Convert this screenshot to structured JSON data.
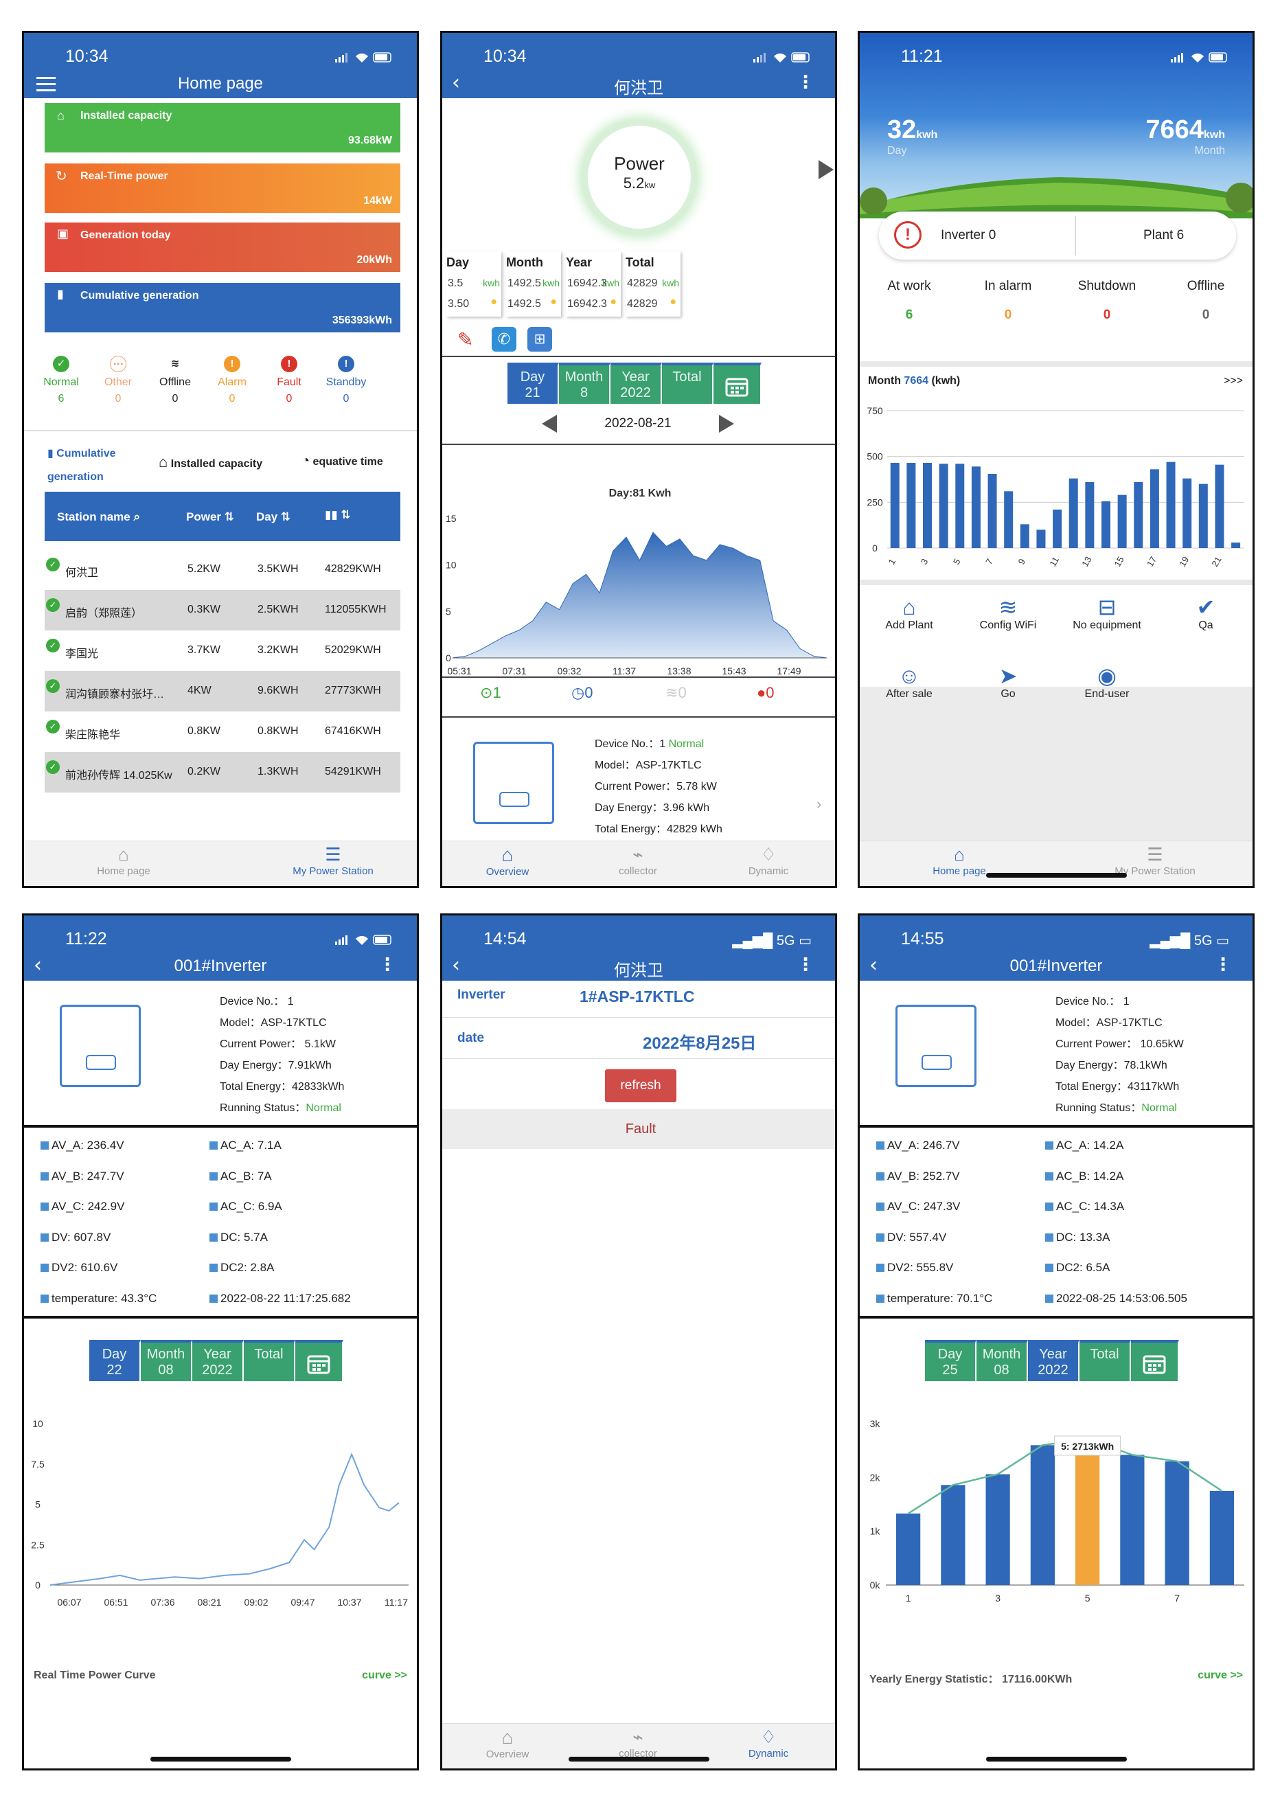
{
  "screens": {
    "s1": {
      "time": "10:34",
      "title": "Home page",
      "cards": [
        {
          "label": "Installed capacity",
          "value": "93.68kW"
        },
        {
          "label": "Real-Time power",
          "value": "14kW"
        },
        {
          "label": "Generation today",
          "value": "20kWh"
        },
        {
          "label": "Cumulative generation",
          "value": "356393kWh"
        }
      ],
      "statuses": [
        {
          "label": "Normal",
          "count": "6",
          "color": "#3caa3c"
        },
        {
          "label": "Other",
          "count": "0",
          "color": "#f0a070"
        },
        {
          "label": "Offline",
          "count": "0",
          "color": "#222222"
        },
        {
          "label": "Alarm",
          "count": "0",
          "color": "#f39a2c"
        },
        {
          "label": "Fault",
          "count": "0",
          "color": "#d9342b"
        },
        {
          "label": "Standby",
          "count": "0",
          "color": "#2f68b8"
        }
      ],
      "sort": {
        "cumulative": "Cumulative generation",
        "installed": "Installed capacity",
        "equative": "equative time"
      },
      "table": {
        "headers": [
          "Station name",
          "Power",
          "Day",
          ""
        ],
        "rows": [
          [
            "何洪卫",
            "5.2KW",
            "3.5KWH",
            "42829KWH"
          ],
          [
            "启韵（郑照莲）",
            "0.3KW",
            "2.5KWH",
            "112055KWH"
          ],
          [
            "李国光",
            "3.7KW",
            "3.2KWH",
            "52029KWH"
          ],
          [
            "润沟镇顾寨村张圩…",
            "4KW",
            "9.6KWH",
            "27773KWH"
          ],
          [
            "柴庄陈艳华",
            "0.8KW",
            "0.8KWH",
            "67416KWH"
          ],
          [
            "前池孙传辉 14.025Kw",
            "0.2KW",
            "1.3KWH",
            "54291KWH"
          ]
        ]
      },
      "tabs": [
        "Home page",
        "My Power Station"
      ]
    },
    "s2": {
      "time": "10:34",
      "title": "何洪卫",
      "gauge_label": "Power",
      "gauge_value": "5.2",
      "gauge_unit": "kw",
      "stats": [
        {
          "label": "Day",
          "a": "3.5",
          "b": "3.50",
          "unit": "kwh"
        },
        {
          "label": "Month",
          "a": "1492.5",
          "b": "1492.5",
          "unit": "kwh"
        },
        {
          "label": "Year",
          "a": "16942.3",
          "b": "16942.3",
          "unit": "kwh"
        },
        {
          "label": "Total",
          "a": "42829",
          "b": "42829",
          "unit": "kwh"
        }
      ],
      "seg": [
        {
          "l": "Day",
          "v": "21"
        },
        {
          "l": "Month",
          "v": "8"
        },
        {
          "l": "Year",
          "v": "2022"
        },
        {
          "l": "Total",
          "v": ""
        }
      ],
      "date": "2022-08-21",
      "chart_title": "Day:81 Kwh",
      "icons_counts": [
        "1",
        "0",
        "0",
        "0"
      ],
      "device": {
        "no_label": "Device No.：",
        "no": "1",
        "status": "Normal",
        "model": "Model：ASP-17KTLC",
        "power": "Current Power：5.78 kW",
        "day": "Day Energy：3.96 kWh",
        "total": "Total Energy：42829 kWh"
      },
      "tabs": [
        "Overview",
        "collector",
        "Dynamic"
      ]
    },
    "s3": {
      "time": "11:21",
      "day_value": "32",
      "day_unit": "kwh",
      "day_label": "Day",
      "month_value": "7664",
      "month_unit": "kwh",
      "month_label": "Month",
      "inverter": "Inverter 0",
      "plant": "Plant 6",
      "states": [
        {
          "label": "At work",
          "v": "6",
          "c": "#3caa3c"
        },
        {
          "label": "In alarm",
          "v": "0",
          "c": "#f39a2c"
        },
        {
          "label": "Shutdown",
          "v": "0",
          "c": "#d9342b"
        },
        {
          "label": "Offline",
          "v": "0",
          "c": "#666666"
        }
      ],
      "month_title_a": "Month ",
      "month_title_b": "7664",
      "month_title_c": " (kwh)",
      "more": ">>>",
      "tools": [
        "Add Plant",
        "Config WiFi",
        "No equipment",
        "Qa",
        "After sale",
        "Go",
        "End-user"
      ],
      "tabs": [
        "Home page",
        "My Power Station"
      ]
    },
    "s4": {
      "time": "11:22",
      "title": "001#Inverter",
      "device": {
        "no": "Device No.：  1",
        "model": "Model：ASP-17KTLC",
        "power": "Current Power：  5.1kW",
        "day": "Day Energy：7.91kWh",
        "total": "Total Energy：42833kWh",
        "run_label": "Running Status：",
        "run": "Normal"
      },
      "params": [
        "AV_A: 236.4V",
        "AC_A: 7.1A",
        "AV_B: 247.7V",
        "AC_B: 7A",
        "AV_C: 242.9V",
        "AC_C: 6.9A",
        "DV: 607.8V",
        "DC: 5.7A",
        "DV2: 610.6V",
        "DC2: 2.8A",
        "temperature:    43.3°C",
        "2022-08-22 11:17:25.682"
      ],
      "seg": [
        {
          "l": "Day",
          "v": "22"
        },
        {
          "l": "Month",
          "v": "08"
        },
        {
          "l": "Year",
          "v": "2022"
        },
        {
          "l": "Total",
          "v": ""
        }
      ],
      "footer": "Real Time Power Curve",
      "curve": "curve >>"
    },
    "s5": {
      "time": "14:54",
      "net": "5G",
      "title": "何洪卫",
      "inv_label": "Inverter",
      "inv_value": "1#ASP-17KTLC",
      "date_label": "date",
      "date_value": "2022年8月25日",
      "refresh": "refresh",
      "fault": "Fault",
      "tabs": [
        "Overview",
        "collector",
        "Dynamic"
      ]
    },
    "s6": {
      "time": "14:55",
      "net": "5G",
      "title": "001#Inverter",
      "device": {
        "no": "Device No.：  1",
        "model": "Model：ASP-17KTLC",
        "power": "Current Power：  10.65kW",
        "day": "Day Energy：78.1kWh",
        "total": "Total Energy：43117kWh",
        "run_label": "Running Status：",
        "run": "Normal"
      },
      "params": [
        "AV_A: 246.7V",
        "AC_A: 14.2A",
        "AV_B: 252.7V",
        "AC_B: 14.2A",
        "AV_C: 247.3V",
        "AC_C: 14.3A",
        "DV: 557.4V",
        "DC: 13.3A",
        "DV2: 555.8V",
        "DC2: 6.5A",
        "temperature:    70.1°C",
        "2022-08-25 14:53:06.505"
      ],
      "seg": [
        {
          "l": "Day",
          "v": "25"
        },
        {
          "l": "Month",
          "v": "08"
        },
        {
          "l": "Year",
          "v": "2022"
        },
        {
          "l": "Total",
          "v": ""
        }
      ],
      "tooltip": "5:  2713kWh",
      "footer": "Yearly Energy Statistic：  17116.00KWh",
      "curve": "curve >>"
    }
  },
  "chart_data": [
    {
      "type": "area",
      "title": "Day:81 Kwh",
      "x_ticks": [
        "05:31",
        "07:31",
        "09:32",
        "11:37",
        "13:38",
        "15:43",
        "17:49"
      ],
      "ylim": [
        0,
        15
      ],
      "y_ticks": [
        "0",
        "5",
        "10",
        "15"
      ],
      "x": [
        0,
        0.5,
        1,
        1.5,
        2,
        2.5,
        3,
        3.5,
        4,
        4.5,
        5,
        5.5,
        6,
        6.5,
        7,
        7.5,
        8,
        8.5,
        9,
        9.5,
        10,
        10.5,
        11,
        11.5,
        12,
        12.5,
        13,
        13.5,
        14
      ],
      "values": [
        0,
        0.2,
        0.8,
        1.6,
        2.4,
        3,
        4,
        6,
        5.2,
        8,
        9,
        7,
        11.5,
        13,
        10.5,
        13.5,
        12,
        12.8,
        11,
        10.5,
        12.2,
        11.8,
        11,
        10.5,
        4,
        3,
        1,
        0.2,
        0
      ]
    },
    {
      "type": "bar",
      "title": "Month 7664 (kwh)",
      "categories": [
        "1",
        "2",
        "3",
        "4",
        "5",
        "6",
        "7",
        "8",
        "9",
        "10",
        "11",
        "12",
        "13",
        "14",
        "15",
        "16",
        "17",
        "18",
        "19",
        "20",
        "21",
        "22"
      ],
      "x_ticks": [
        "1",
        "3",
        "5",
        "7",
        "9",
        "11",
        "13",
        "15",
        "17",
        "19",
        "21"
      ],
      "ylim": [
        0,
        750
      ],
      "y_ticks": [
        "0",
        "250",
        "500",
        "750"
      ],
      "values": [
        465,
        465,
        465,
        460,
        460,
        445,
        405,
        310,
        130,
        100,
        210,
        380,
        360,
        255,
        290,
        360,
        430,
        470,
        380,
        350,
        455,
        30
      ]
    },
    {
      "type": "line",
      "title": "Real Time Power Curve",
      "x_ticks": [
        "06:07",
        "06:51",
        "07:36",
        "08:21",
        "09:02",
        "09:47",
        "10:37",
        "11:17"
      ],
      "ylim": [
        0,
        10
      ],
      "y_ticks": [
        "0",
        "2.5",
        "5",
        "7.5",
        "10"
      ],
      "x": [
        0,
        0.5,
        1,
        1.4,
        1.8,
        2.5,
        3,
        3.5,
        4,
        4.4,
        4.8,
        5.1,
        5.3,
        5.6,
        5.8,
        6.05,
        6.3,
        6.6,
        6.8,
        7
      ],
      "values": [
        0,
        0.2,
        0.4,
        0.6,
        0.3,
        0.5,
        0.4,
        0.6,
        0.7,
        1,
        1.4,
        2.8,
        2.2,
        3.6,
        6.2,
        8.1,
        6.2,
        4.8,
        4.6,
        5.1
      ]
    },
    {
      "type": "bar",
      "title": "Yearly Energy Statistic",
      "categories": [
        "1",
        "2",
        "3",
        "4",
        "5",
        "6",
        "7",
        "8"
      ],
      "x_ticks": [
        "1",
        "3",
        "5",
        "7"
      ],
      "ylim": [
        0,
        3000
      ],
      "y_ticks": [
        "0k",
        "1k",
        "2k",
        "3k"
      ],
      "values": [
        1330,
        1860,
        2060,
        2600,
        2713,
        2420,
        2300,
        1750
      ],
      "highlight": "5",
      "trend_line": true
    }
  ]
}
